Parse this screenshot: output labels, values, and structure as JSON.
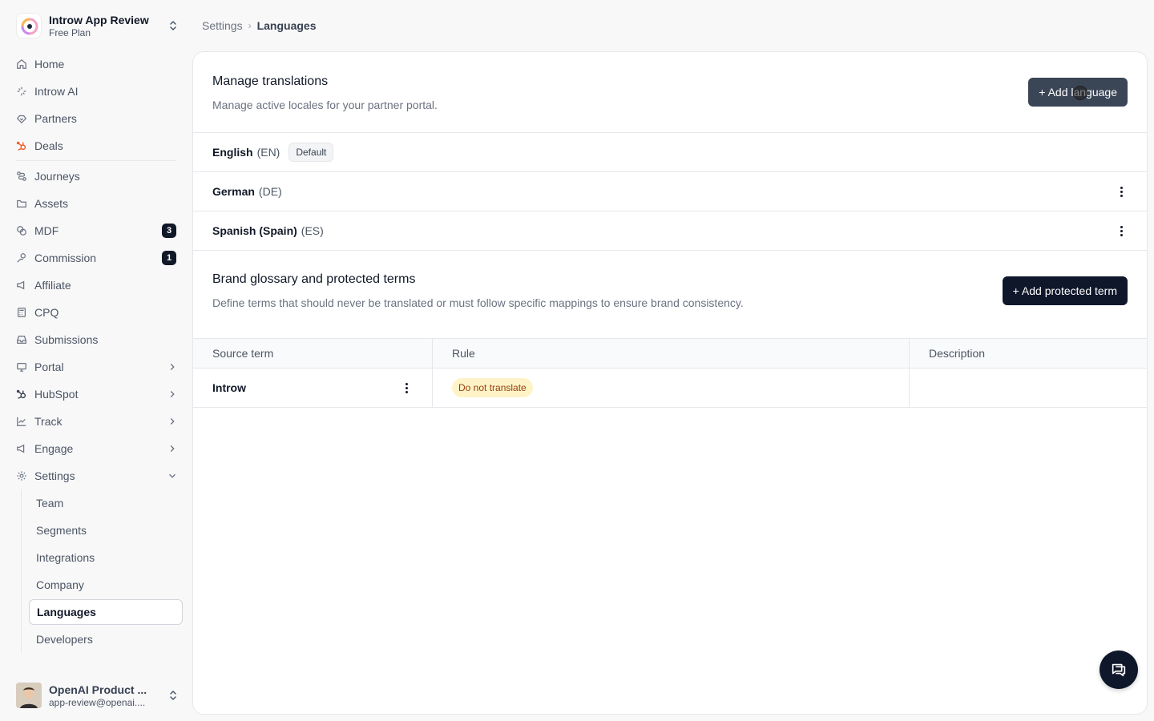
{
  "workspace": {
    "name": "Introw App Review",
    "plan": "Free Plan"
  },
  "nav": {
    "primary": [
      {
        "key": "home",
        "label": "Home",
        "icon": "home-icon"
      },
      {
        "key": "introw-ai",
        "label": "Introw AI",
        "icon": "sparkle-icon"
      },
      {
        "key": "partners",
        "label": "Partners",
        "icon": "handshake-icon"
      },
      {
        "key": "deals",
        "label": "Deals",
        "icon": "hubspot-icon"
      }
    ],
    "secondary": [
      {
        "key": "journeys",
        "label": "Journeys",
        "icon": "route-icon"
      },
      {
        "key": "assets",
        "label": "Assets",
        "icon": "folder-icon"
      },
      {
        "key": "mdf",
        "label": "MDF",
        "icon": "coins-icon",
        "badge": "3"
      },
      {
        "key": "commission",
        "label": "Commission",
        "icon": "handcoins-icon",
        "badge": "1"
      },
      {
        "key": "affiliate",
        "label": "Affiliate",
        "icon": "megaphone-icon"
      },
      {
        "key": "cpq",
        "label": "CPQ",
        "icon": "calculator-icon"
      },
      {
        "key": "submissions",
        "label": "Submissions",
        "icon": "inbox-icon"
      },
      {
        "key": "portal",
        "label": "Portal",
        "icon": "monitor-icon"
      },
      {
        "key": "hubspot",
        "label": "HubSpot",
        "icon": "hubspot-icon"
      },
      {
        "key": "track",
        "label": "Track",
        "icon": "chart-line-icon"
      },
      {
        "key": "engage",
        "label": "Engage",
        "icon": "megaphone-icon"
      },
      {
        "key": "settings",
        "label": "Settings",
        "icon": "gear-icon"
      }
    ],
    "settings_sub": [
      {
        "key": "team",
        "label": "Team"
      },
      {
        "key": "segments",
        "label": "Segments"
      },
      {
        "key": "integrations",
        "label": "Integrations"
      },
      {
        "key": "company",
        "label": "Company"
      },
      {
        "key": "languages",
        "label": "Languages",
        "active": true
      },
      {
        "key": "developers",
        "label": "Developers"
      }
    ]
  },
  "user": {
    "name": "OpenAI Product ...",
    "email": "app-review@openai...."
  },
  "breadcrumb": {
    "parent": "Settings",
    "current": "Languages"
  },
  "translations": {
    "title": "Manage translations",
    "description": "Manage active locales for your partner portal.",
    "add_label": "+ Add language",
    "languages": [
      {
        "name": "English",
        "code": "(EN)",
        "badge": "Default"
      },
      {
        "name": "German",
        "code": "(DE)"
      },
      {
        "name": "Spanish (Spain)",
        "code": "(ES)"
      }
    ]
  },
  "glossary": {
    "title": "Brand glossary and protected terms",
    "description": "Define terms that should never be translated or must follow specific mappings to ensure brand consistency.",
    "add_label": "+ Add protected term",
    "columns": {
      "source": "Source term",
      "rule": "Rule",
      "description": "Description"
    },
    "rows": [
      {
        "source": "Introw",
        "rule": "Do not translate",
        "description": ""
      }
    ]
  },
  "colors": {
    "accent": "#0f172a",
    "button_hover": "#3a4556",
    "rule_badge_bg": "#fef3c7",
    "rule_badge_text": "#92400e",
    "deals_icon": "#f0592a"
  }
}
